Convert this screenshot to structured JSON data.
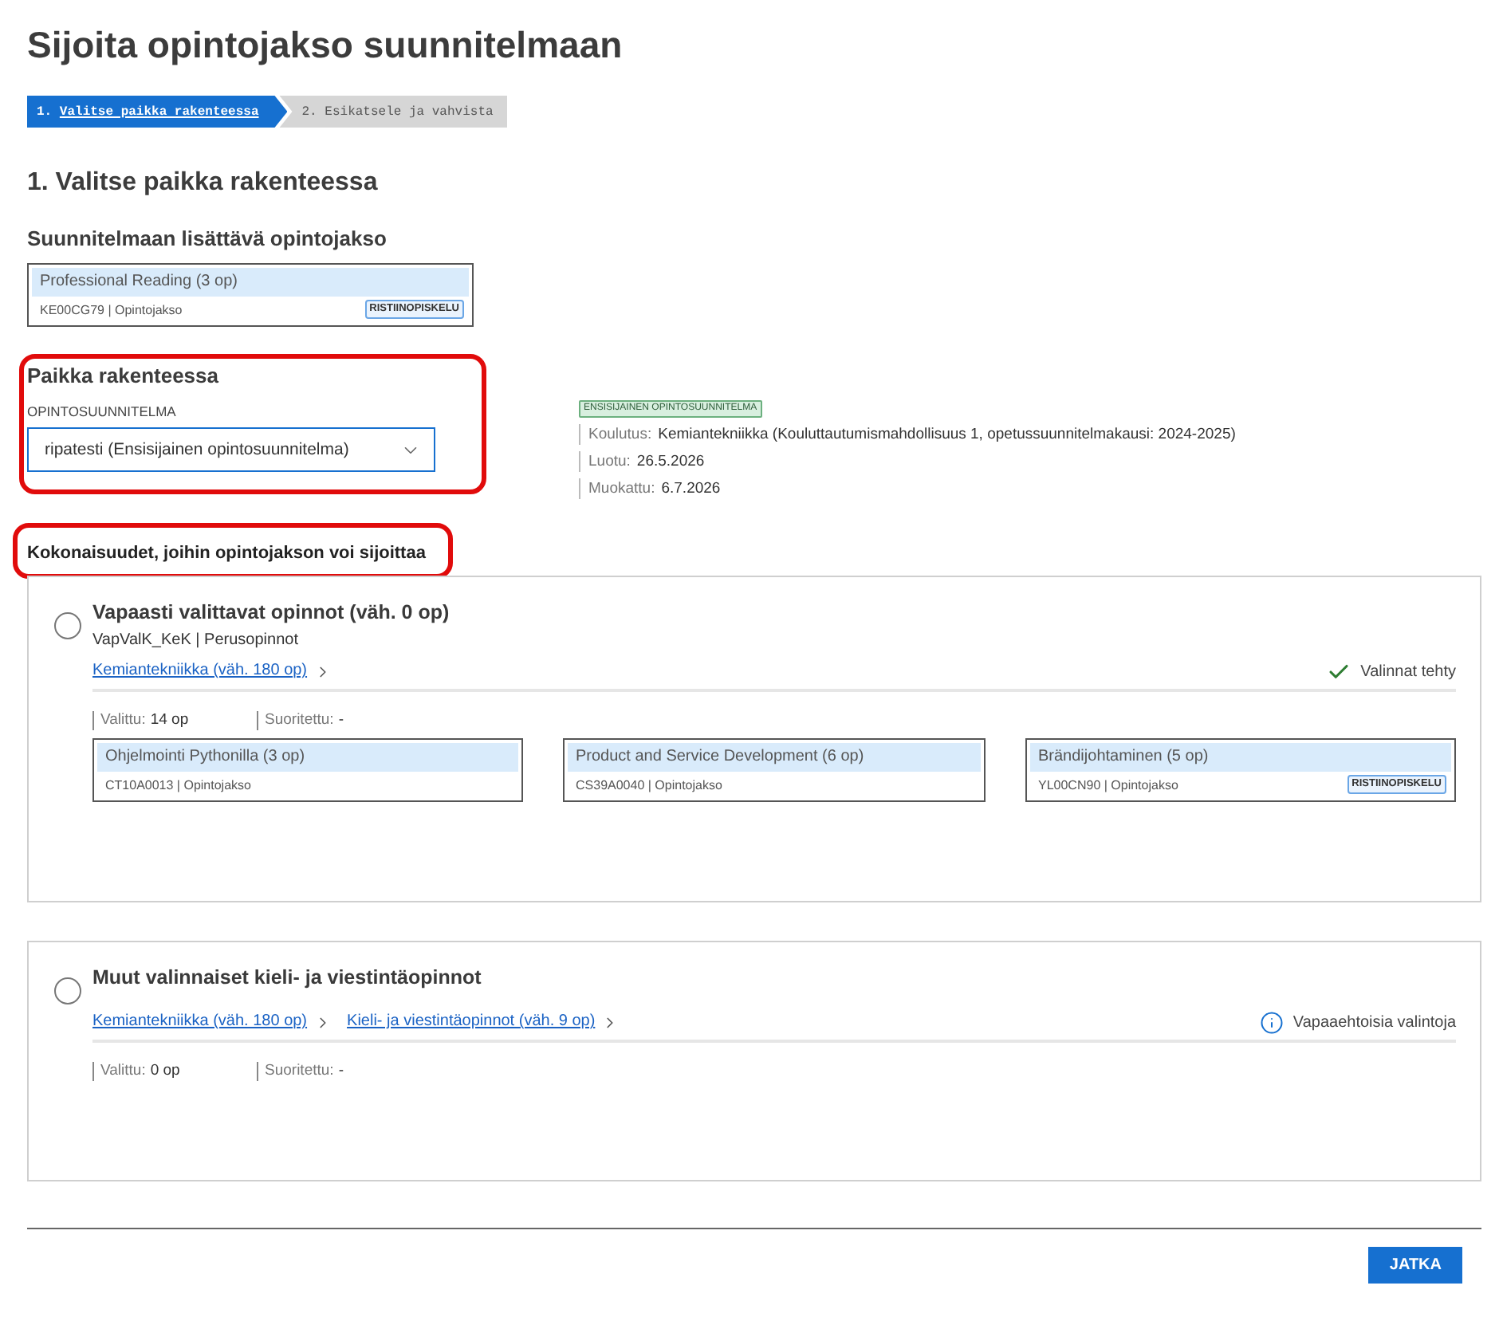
{
  "page": {
    "title": "Sijoita opintojakso suunnitelmaan"
  },
  "steps": [
    {
      "number": "1.",
      "label": "Valitse paikka rakenteessa",
      "selected": true
    },
    {
      "number": "2.",
      "label": "Esikatsele ja vahvista",
      "selected": false
    }
  ],
  "section_heading": "1. Valitse paikka rakenteessa",
  "course_to_add": {
    "heading": "Suunnitelmaan lisättävä opintojakso",
    "card": {
      "title": "Professional Reading (3 op)",
      "meta": "KE00CG79 | Opintojakso",
      "badge": "RISTIINOPISKELU"
    }
  },
  "placement": {
    "heading": "Paikka rakenteessa",
    "highlighted": true,
    "field_label": "OPINTOSUUNNITELMA",
    "select_value": "ripatesti (Ensisijainen opintosuunnitelma)"
  },
  "plan_info": {
    "badge": "ENSISIJAINEN OPINTOSUUNNITELMA",
    "rows": [
      {
        "label": "Koulutus:",
        "value": "Kemiantekniikka (Kouluttautumismahdollisuus 1, opetussuunnitelmakausi: 2024-2025)"
      },
      {
        "label": "Luotu:",
        "value": "26.5.2026"
      },
      {
        "label": "Muokattu:",
        "value": "6.7.2026"
      }
    ]
  },
  "modules_heading": {
    "text": "Kokonaisuudet, joihin opintojakson voi sijoittaa",
    "highlighted": true
  },
  "modules": [
    {
      "title": "Vapaasti valittavat opinnot (väh. 0 op)",
      "selected": false,
      "subtitle": "VapValK_KeK | Perusopinnot",
      "breadcrumbs": [
        "Kemiantekniikka (väh. 180 op)"
      ],
      "status": {
        "kind": "done",
        "text": "Valinnat tehty"
      },
      "stats": [
        {
          "label": "Valittu:",
          "value": "14 op"
        },
        {
          "label": "Suoritettu:",
          "value": "-"
        }
      ],
      "courses": [
        {
          "title": "Ohjelmointi Pythonilla (3 op)",
          "meta": "CT10A0013 | Opintojakso"
        },
        {
          "title": "Product and Service Development (6 op)",
          "meta": "CS39A0040 | Opintojakso"
        },
        {
          "title": "Brändijohtaminen (5 op)",
          "meta": "YL00CN90 | Opintojakso",
          "badge": "RISTIINOPISKELU"
        }
      ]
    },
    {
      "title": "Muut valinnaiset kieli- ja viestintäopinnot",
      "selected": false,
      "breadcrumbs": [
        "Kemiantekniikka (väh. 180 op)",
        "Kieli- ja viestintäopinnot (väh. 9 op)"
      ],
      "status": {
        "kind": "info",
        "text": "Vapaaehtoisia valintoja"
      },
      "stats": [
        {
          "label": "Valittu:",
          "value": "0 op"
        },
        {
          "label": "Suoritettu:",
          "value": "-"
        }
      ]
    }
  ],
  "footer": {
    "button": "JATKA"
  }
}
